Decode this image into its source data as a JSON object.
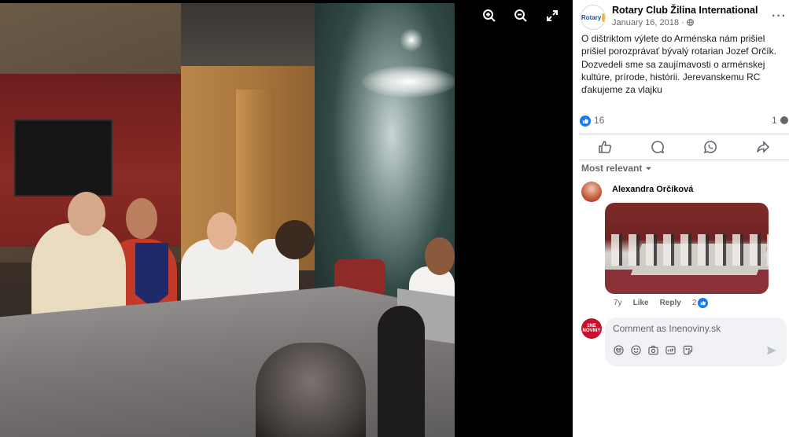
{
  "post": {
    "page_name": "Rotary Club Žilina International",
    "date": "January 16, 2018 ·",
    "text": "O dištriktom výlete do Arménska nám prišiel prišiel porozprávať bývalý rotarian Jozef Orčík. Dozvedeli sme sa zaujímavosti o arménskej kultúre, prírode, histórii. Jerevanskemu RC ďakujeme za vlajku",
    "avatar_label": "Rotary",
    "more_label": "···"
  },
  "reactions": {
    "count": "16",
    "comments": "1"
  },
  "comments": {
    "sort_label": "Most relevant",
    "items": [
      {
        "author": "Alexandra Orčíková",
        "age": "7y",
        "like": "Like",
        "reply": "Reply",
        "likes": "2"
      }
    ],
    "input_placeholder": "Comment as Inenoviny.sk",
    "commenter_label": "1NE\nNOVINY"
  },
  "icons": {
    "zoom_in": "zoom-in-icon",
    "zoom_out": "zoom-out-icon",
    "fullscreen": "fullscreen-icon",
    "like": "like-icon",
    "comment": "comment-icon",
    "whatsapp": "whatsapp-icon",
    "share": "share-icon"
  },
  "colors": {
    "facebook_blue": "#1877f2",
    "text": "#050505",
    "secondary": "#65676b"
  }
}
